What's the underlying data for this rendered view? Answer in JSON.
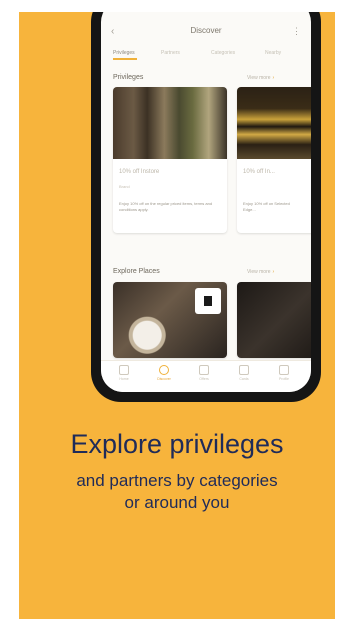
{
  "app": {
    "title": "Discover",
    "back_icon": "‹",
    "more_icon": "⋮",
    "tabs": [
      "Privileges",
      "Partners",
      "Categories",
      "Nearby"
    ],
    "sections": [
      {
        "title": "Privileges",
        "link": "View more"
      },
      {
        "title": "Explore Places",
        "link": "View more"
      }
    ],
    "cards": [
      {
        "title": "10% off Instore",
        "subtitle": "Brand",
        "desc": "Enjoy 10% off on the regular priced items, terms and conditions apply."
      },
      {
        "title": "10% off In...",
        "subtitle": "",
        "desc": "Enjoy 10% off on Selected Edge..."
      }
    ],
    "nav": [
      {
        "label": "Home",
        "icon": "home-icon",
        "active": false
      },
      {
        "label": "Discover",
        "icon": "compass-icon",
        "active": true
      },
      {
        "label": "Offers",
        "icon": "bookmark-icon",
        "active": false
      },
      {
        "label": "Cards",
        "icon": "card-icon",
        "active": false
      },
      {
        "label": "Profile",
        "icon": "profile-icon",
        "active": false
      }
    ]
  },
  "caption": {
    "headline": "Explore privileges",
    "line2": "and partners by categories",
    "line3": "or around you"
  },
  "colors": {
    "background": "#f7b43c",
    "caption": "#1f2b59",
    "accent": "#f0b13a"
  }
}
